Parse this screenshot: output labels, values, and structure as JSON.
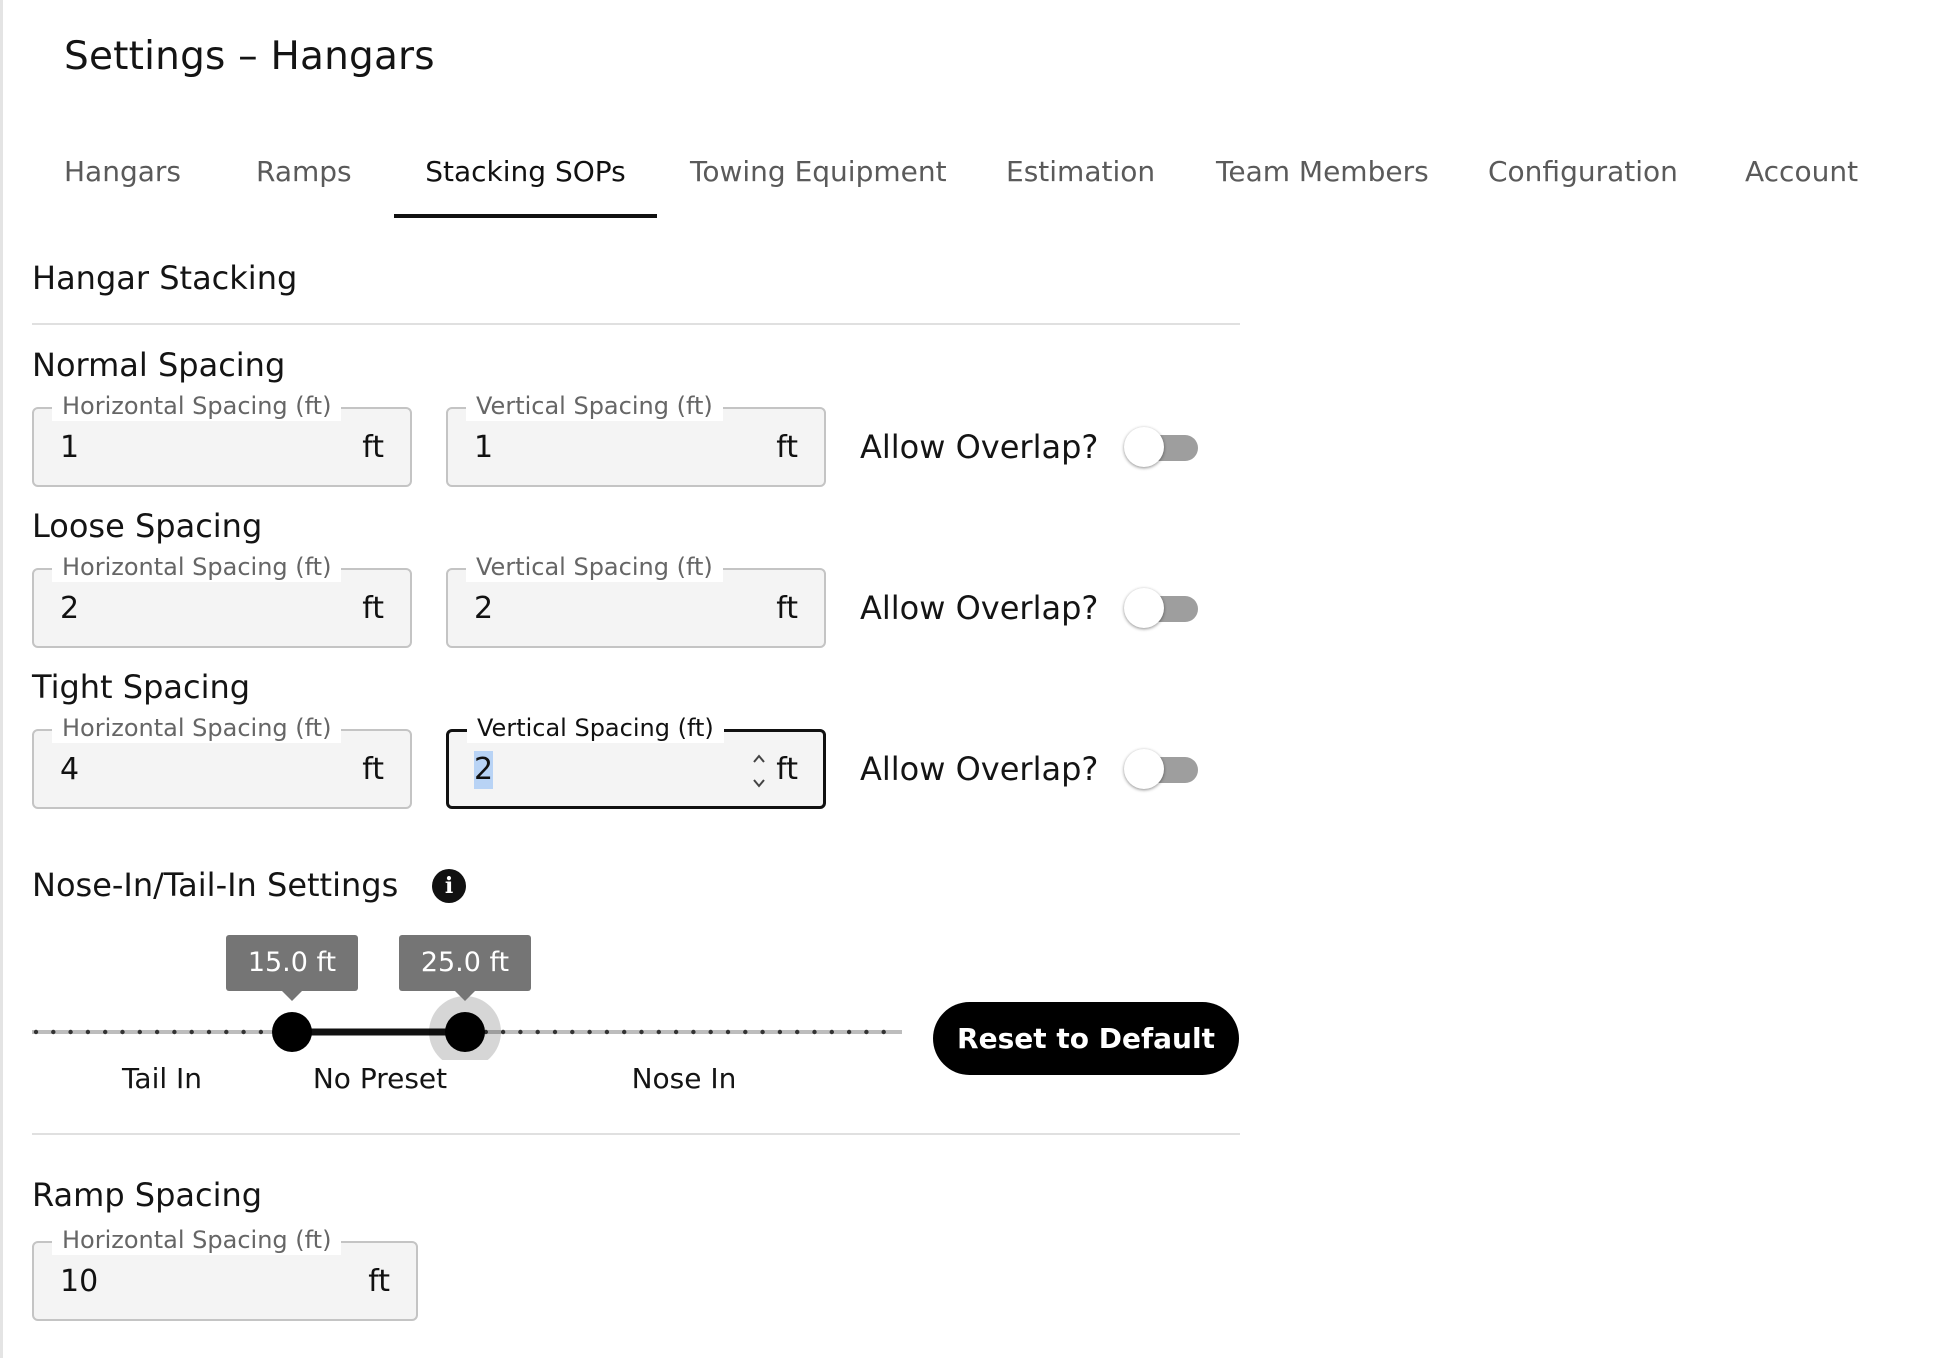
{
  "page": {
    "title": "Settings – Hangars"
  },
  "tabs": [
    {
      "label": "Hangars",
      "active": false
    },
    {
      "label": "Ramps",
      "active": false
    },
    {
      "label": "Stacking SOPs",
      "active": true
    },
    {
      "label": "Towing Equipment",
      "active": false
    },
    {
      "label": "Estimation",
      "active": false
    },
    {
      "label": "Team Members",
      "active": false
    },
    {
      "label": "Configuration",
      "active": false
    },
    {
      "label": "Account",
      "active": false
    }
  ],
  "hangar_stacking": {
    "title": "Hangar Stacking",
    "spacings": [
      {
        "title": "Normal Spacing",
        "horizontal": {
          "label": "Horizontal Spacing (ft)",
          "value": "1",
          "unit": "ft"
        },
        "vertical": {
          "label": "Vertical Spacing (ft)",
          "value": "1",
          "unit": "ft"
        },
        "overlap": {
          "label": "Allow Overlap?",
          "enabled": false
        }
      },
      {
        "title": "Loose Spacing",
        "horizontal": {
          "label": "Horizontal Spacing (ft)",
          "value": "2",
          "unit": "ft"
        },
        "vertical": {
          "label": "Vertical Spacing (ft)",
          "value": "2",
          "unit": "ft"
        },
        "overlap": {
          "label": "Allow Overlap?",
          "enabled": false
        }
      },
      {
        "title": "Tight Spacing",
        "horizontal": {
          "label": "Horizontal Spacing (ft)",
          "value": "4",
          "unit": "ft"
        },
        "vertical": {
          "label": "Vertical Spacing (ft)",
          "value": "2",
          "unit": "ft",
          "focused": true,
          "selected": true
        },
        "overlap": {
          "label": "Allow Overlap?",
          "enabled": false
        }
      }
    ]
  },
  "nose_tail": {
    "title": "Nose-In/Tail-In Settings",
    "icon": "info-icon",
    "slider": {
      "low_value": 15.0,
      "high_value": 25.0,
      "low_label": "15.0 ft",
      "high_label": "25.0 ft",
      "active_thumb": "high"
    },
    "marks": [
      "Tail In",
      "No Preset",
      "Nose In"
    ],
    "reset_label": "Reset to Default"
  },
  "ramp_spacing": {
    "title": "Ramp Spacing",
    "horizontal": {
      "label": "Horizontal Spacing (ft)",
      "value": "10",
      "unit": "ft"
    }
  },
  "colors": {
    "accent": "#111111",
    "switch_track_off": "#9e9e9e",
    "tooltip": "#757575",
    "field_bg": "#f4f4f4",
    "selection": "#b8d3f5"
  }
}
